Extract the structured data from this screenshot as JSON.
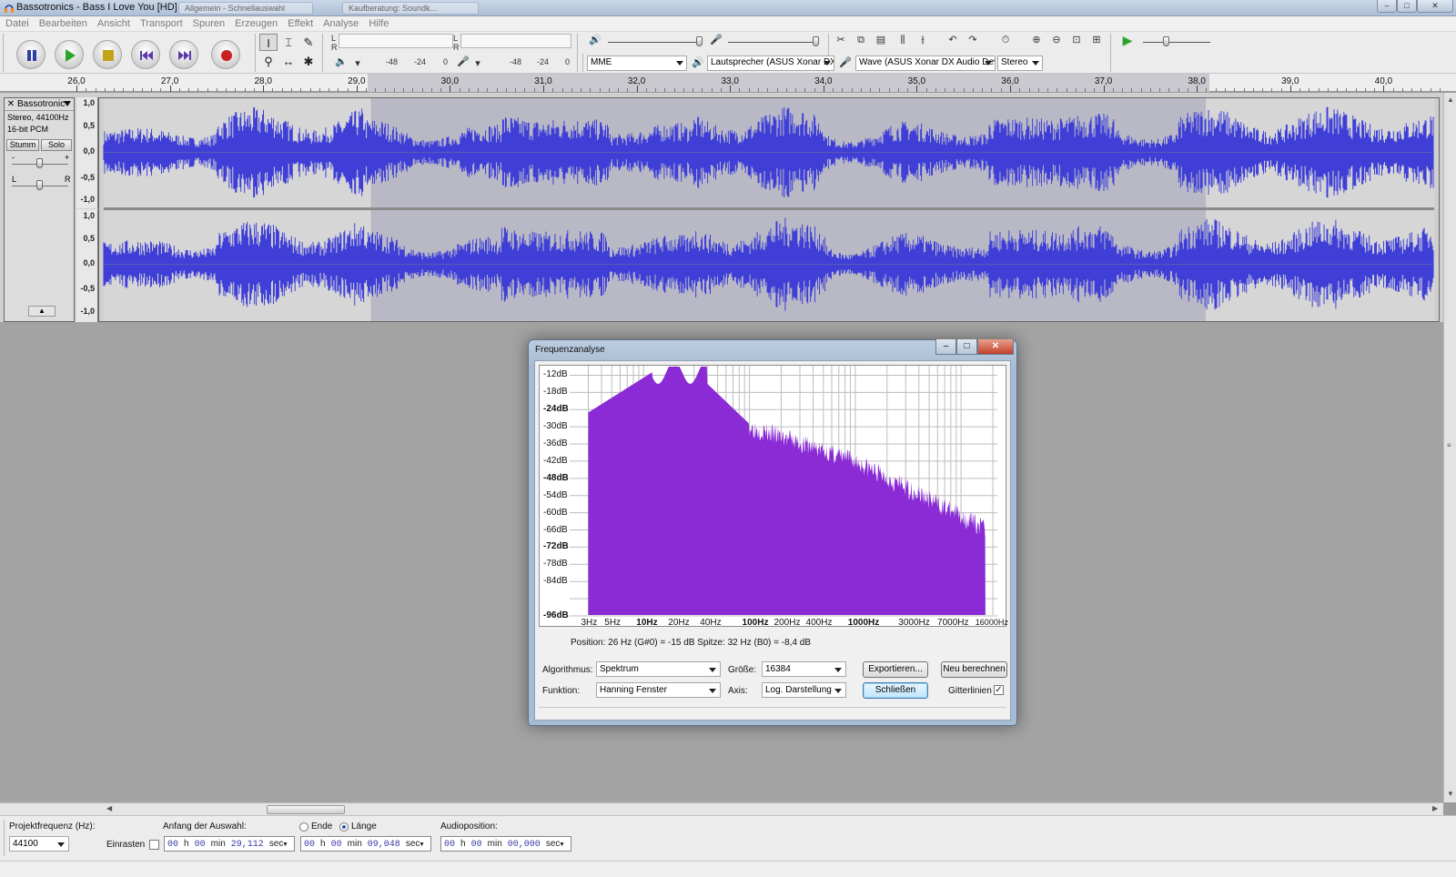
{
  "window": {
    "title": "Bassotronics - Bass I Love You [HD]",
    "min": "–",
    "max": "□",
    "close": "✕",
    "ghost_tabs": [
      "Allgemein - Schnellauswahl",
      "Kaufberatung: Soundk..."
    ]
  },
  "menu": [
    "Datei",
    "Bearbeiten",
    "Ansicht",
    "Transport",
    "Spuren",
    "Erzeugen",
    "Effekt",
    "Analyse",
    "Hilfe"
  ],
  "meters": {
    "left": "L",
    "right": "R",
    "playback_scale": [
      "-48",
      "-24",
      "0"
    ],
    "record_scale": [
      "-48",
      "-24",
      "0"
    ]
  },
  "device": {
    "host": "MME",
    "output": "Lautsprecher (ASUS Xonar DX",
    "input": "Wave (ASUS Xonar DX Audio Devi",
    "channels": "Stereo"
  },
  "ruler": {
    "labels": [
      "26,0",
      "27,0",
      "28,0",
      "29,0",
      "30,0",
      "31,0",
      "32,0",
      "33,0",
      "34,0",
      "35,0",
      "36,0",
      "37,0",
      "38,0",
      "39,0",
      "40,0"
    ]
  },
  "track": {
    "name": "Bassotronic",
    "close": "✕",
    "info_line1": "Stereo, 44100Hz",
    "info_line2": "16-bit PCM",
    "mute": "Stumm",
    "solo": "Solo",
    "gain_minus": "-",
    "gain_plus": "+",
    "pan_left": "L",
    "pan_right": "R",
    "collapse": "▲",
    "scale": [
      "1,0",
      "0,5",
      "0,0",
      "-0,5",
      "-1,0"
    ]
  },
  "dialog": {
    "title": "Frequenzanalyse",
    "min": "–",
    "max": "□",
    "close": "✕",
    "db_labels": [
      "-12dB",
      "-18dB",
      "-24dB",
      "-30dB",
      "-36dB",
      "-42dB",
      "-48dB",
      "-54dB",
      "-60dB",
      "-66dB",
      "-72dB",
      "-78dB",
      "-84dB",
      "-96dB"
    ],
    "freq_labels": [
      "3Hz",
      "5Hz",
      "10Hz",
      "20Hz",
      "40Hz",
      "100Hz",
      "200Hz",
      "400Hz",
      "1000Hz",
      "3000Hz",
      "7000Hz",
      "16000Hz"
    ],
    "position_text": "Position: 26 Hz (G#0) = -15 dB     Spitze: 32 Hz (B0) = -8,4 dB",
    "algorithm_label": "Algorithmus:",
    "algorithm_value": "Spektrum",
    "size_label": "Größe:",
    "size_value": "16384",
    "export_button": "Exportieren...",
    "recalc_button": "Neu berechnen",
    "function_label": "Funktion:",
    "function_value": "Hanning Fenster",
    "axis_label": "Axis:",
    "axis_value": "Log. Darstellung",
    "close_button": "Schließen",
    "grid_label": "Gitterlinien",
    "grid_checked": "✓",
    "accent_color": "#8a2bd6"
  },
  "selection_bar": {
    "rate_label": "Projektfrequenz (Hz):",
    "rate_value": "44100",
    "snap_label": "Einrasten",
    "start_label": "Anfang der Auswahl:",
    "end_radio": "Ende",
    "length_radio": "Länge",
    "audio_pos_label": "Audioposition:",
    "start": {
      "h": "00",
      "m": "00",
      "s": "29,112",
      "u_h": "h",
      "u_m": "min",
      "u_s": "sec"
    },
    "length": {
      "h": "00",
      "m": "00",
      "s": "09,048",
      "u_h": "h",
      "u_m": "min",
      "u_s": "sec"
    },
    "audio_pos": {
      "h": "00",
      "m": "00",
      "s": "00,000",
      "u_h": "h",
      "u_m": "min",
      "u_s": "sec"
    }
  },
  "colors": {
    "waveform": "#3f3fd8",
    "waveform_bg": "#d6d6d6",
    "waveform_sel": "#b9b9c6"
  }
}
